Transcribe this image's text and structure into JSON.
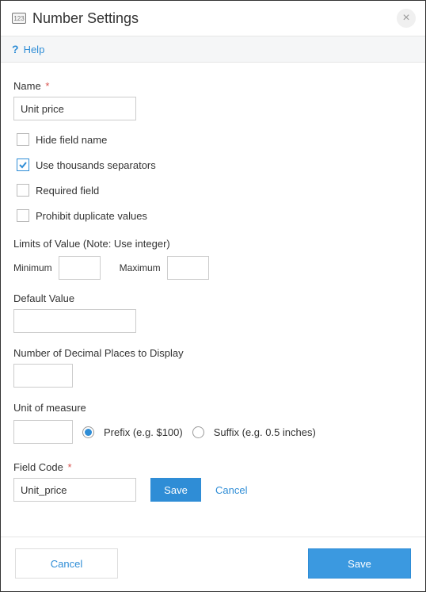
{
  "header": {
    "icon_text": "123",
    "title": "Number Settings",
    "close_glyph": "×"
  },
  "help": {
    "icon": "?",
    "label": "Help"
  },
  "form": {
    "name": {
      "label": "Name",
      "required_mark": "*",
      "value": "Unit price"
    },
    "checkboxes": {
      "hide_field_name": {
        "label": "Hide field name",
        "checked": false
      },
      "thousands_sep": {
        "label": "Use thousands separators",
        "checked": true
      },
      "required_field": {
        "label": "Required field",
        "checked": false
      },
      "prohibit_dup": {
        "label": "Prohibit duplicate values",
        "checked": false
      }
    },
    "limits": {
      "label": "Limits of Value (Note: Use integer)",
      "min_label": "Minimum",
      "min_value": "",
      "max_label": "Maximum",
      "max_value": ""
    },
    "default_value": {
      "label": "Default Value",
      "value": ""
    },
    "decimal_places": {
      "label": "Number of Decimal Places to Display",
      "value": ""
    },
    "unit_of_measure": {
      "label": "Unit of measure",
      "value": "",
      "prefix": {
        "label": "Prefix (e.g. $100)",
        "checked": true
      },
      "suffix": {
        "label": "Suffix (e.g. 0.5 inches)",
        "checked": false
      }
    },
    "field_code": {
      "label": "Field Code",
      "required_mark": "*",
      "value": "Unit_price",
      "save_label": "Save",
      "cancel_label": "Cancel"
    }
  },
  "footer": {
    "cancel_label": "Cancel",
    "save_label": "Save"
  }
}
